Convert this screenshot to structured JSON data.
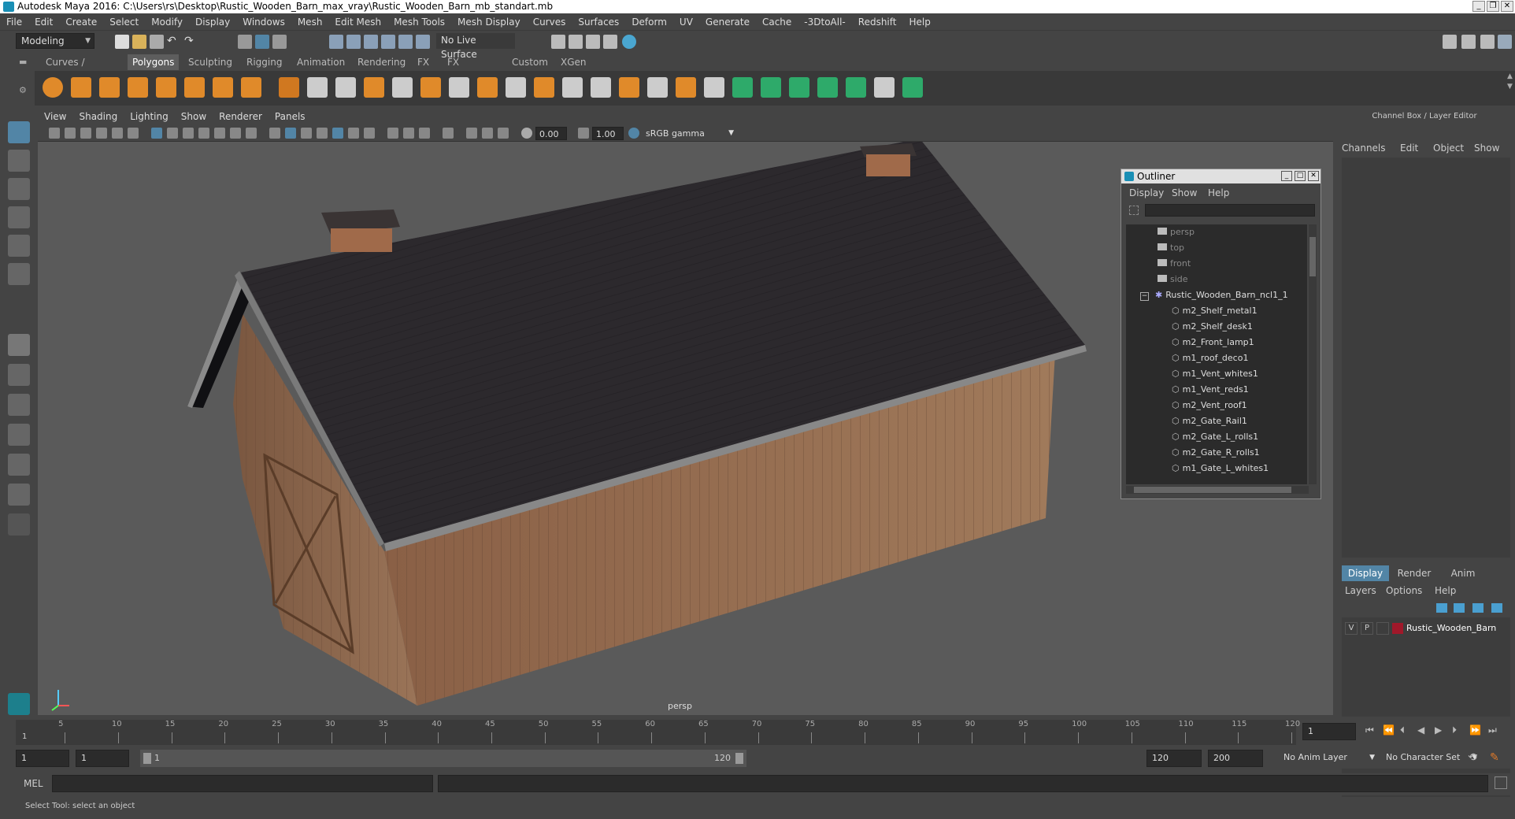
{
  "window": {
    "title": "Autodesk Maya 2016: C:\\Users\\rs\\Desktop\\Rustic_Wooden_Barn_max_vray\\Rustic_Wooden_Barn_mb_standart.mb",
    "min": "_",
    "max": "❐",
    "close": "✕"
  },
  "menubar": [
    "File",
    "Edit",
    "Create",
    "Select",
    "Modify",
    "Display",
    "Windows",
    "Mesh",
    "Edit Mesh",
    "Mesh Tools",
    "Mesh Display",
    "Curves",
    "Surfaces",
    "Deform",
    "UV",
    "Generate",
    "Cache",
    "-3DtoAll-",
    "Redshift",
    "Help"
  ],
  "statusline": {
    "mode": "Modeling",
    "live_surface": "No Live Surface"
  },
  "shelf": {
    "tabs": [
      "Curves / Surfaces",
      "Polygons",
      "Sculpting",
      "Rigging",
      "Animation",
      "Rendering",
      "FX",
      "FX Caching",
      "Custom",
      "XGen"
    ],
    "active_tab": "Polygons"
  },
  "viewport": {
    "menu": [
      "View",
      "Shading",
      "Lighting",
      "Show",
      "Renderer",
      "Panels"
    ],
    "exposure": "0.00",
    "gamma": "1.00",
    "color_space": "sRGB gamma",
    "camera_label": "persp"
  },
  "outliner": {
    "title": "Outliner",
    "menu": [
      "Display",
      "Show",
      "Help"
    ],
    "items": [
      {
        "label": "persp",
        "type": "camera"
      },
      {
        "label": "top",
        "type": "camera"
      },
      {
        "label": "front",
        "type": "camera"
      },
      {
        "label": "side",
        "type": "camera"
      },
      {
        "label": "Rustic_Wooden_Barn_ncl1_1",
        "type": "group"
      },
      {
        "label": "m2_Shelf_metal1",
        "type": "mesh"
      },
      {
        "label": "m2_Shelf_desk1",
        "type": "mesh"
      },
      {
        "label": "m2_Front_lamp1",
        "type": "mesh"
      },
      {
        "label": "m1_roof_deco1",
        "type": "mesh"
      },
      {
        "label": "m1_Vent_whites1",
        "type": "mesh"
      },
      {
        "label": "m1_Vent_reds1",
        "type": "mesh"
      },
      {
        "label": "m2_Vent_roof1",
        "type": "mesh"
      },
      {
        "label": "m2_Gate_Rail1",
        "type": "mesh"
      },
      {
        "label": "m2_Gate_L_rolls1",
        "type": "mesh"
      },
      {
        "label": "m2_Gate_R_rolls1",
        "type": "mesh"
      },
      {
        "label": "m1_Gate_L_whites1",
        "type": "mesh"
      }
    ]
  },
  "channelbox": {
    "title": "Channel Box / Layer Editor",
    "menu": [
      "Channels",
      "Edit",
      "Object",
      "Show"
    ],
    "tabs": [
      "Display",
      "Render",
      "Anim"
    ],
    "active_tab": "Display",
    "layer_menu": [
      "Layers",
      "Options",
      "Help"
    ],
    "layer": {
      "v": "V",
      "p": "P",
      "name": "Rustic_Wooden_Barn",
      "color": "#a0182a"
    }
  },
  "timeline": {
    "ticks": [
      "5",
      "10",
      "15",
      "20",
      "25",
      "30",
      "35",
      "40",
      "45",
      "50",
      "55",
      "60",
      "65",
      "70",
      "75",
      "80",
      "85",
      "90",
      "95",
      "100",
      "105",
      "110",
      "115",
      "120"
    ],
    "start_marker": "1",
    "current_frame": "1"
  },
  "range": {
    "start": "1",
    "playback_start": "1",
    "slider_start": "1",
    "slider_end": "120",
    "playback_end": "120",
    "end": "200",
    "anim_layer": "No Anim Layer",
    "character_set": "No Character Set"
  },
  "cmdline": {
    "label": "MEL"
  },
  "helpline": {
    "text": "Select Tool: select an object"
  },
  "colors": {
    "accent": "#5285a6",
    "active_tab": "#5d5d5d",
    "roof": "#2a272b",
    "wood": "#8a6347"
  }
}
